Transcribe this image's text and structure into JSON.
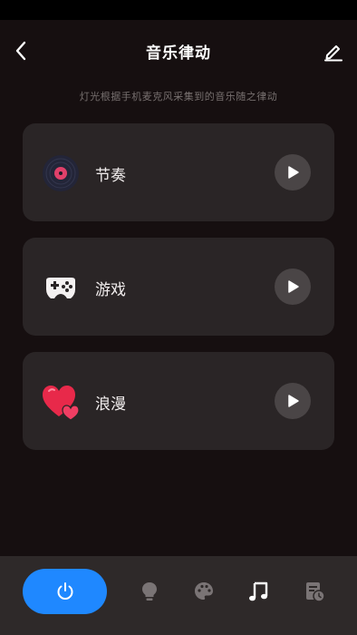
{
  "header": {
    "title": "音乐律动",
    "back_icon": "chevron-left-icon",
    "edit_icon": "pencil-icon"
  },
  "subtitle": "灯光根据手机麦克风采集到的音乐随之律动",
  "modes": [
    {
      "label": "节奏",
      "icon": "vinyl-record-icon"
    },
    {
      "label": "游戏",
      "icon": "gamepad-icon"
    },
    {
      "label": "浪漫",
      "icon": "hearts-icon"
    }
  ],
  "bottom_nav": {
    "power_icon": "power-icon",
    "items": [
      {
        "icon": "lightbulb-icon",
        "active": false
      },
      {
        "icon": "palette-icon",
        "active": false
      },
      {
        "icon": "music-note-icon",
        "active": true
      },
      {
        "icon": "schedule-icon",
        "active": false
      }
    ]
  },
  "colors": {
    "background": "#160f10",
    "card": "#2a2526",
    "accent": "#1f88ff",
    "nav_background": "#2e2929",
    "inactive_icon": "#7a7475",
    "active_icon": "#ffffff"
  }
}
